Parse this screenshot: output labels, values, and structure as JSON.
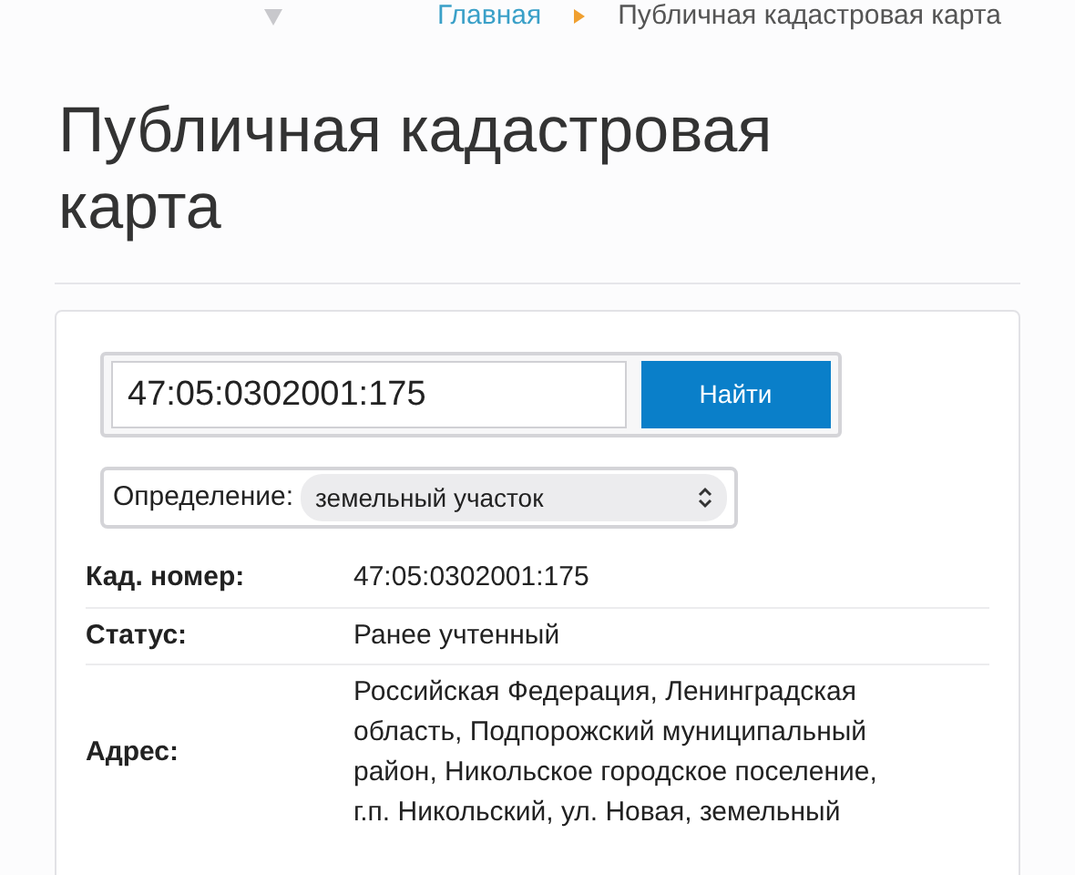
{
  "breadcrumb": [
    {
      "label": "Главная",
      "kind": "link"
    },
    {
      "label": "Публичная кадастровая карта",
      "kind": "current"
    }
  ],
  "title": "Публичная кадастровая карта",
  "search": {
    "value": "47:05:0302001:175",
    "button": "Найти"
  },
  "definition": {
    "label": "Определение:",
    "value": "земельный участок"
  },
  "details": [
    {
      "label": "Кад. номер:",
      "value": "47:05:0302001:175"
    },
    {
      "label": "Статус:",
      "value": "Ранее учтенный"
    },
    {
      "label": "Адрес:",
      "value": "Российская Федерация, Ленинградская область, Подпорожский муниципальный район, Никольское городское поселение, г.п. Никольский, ул. Новая, земельный"
    }
  ]
}
